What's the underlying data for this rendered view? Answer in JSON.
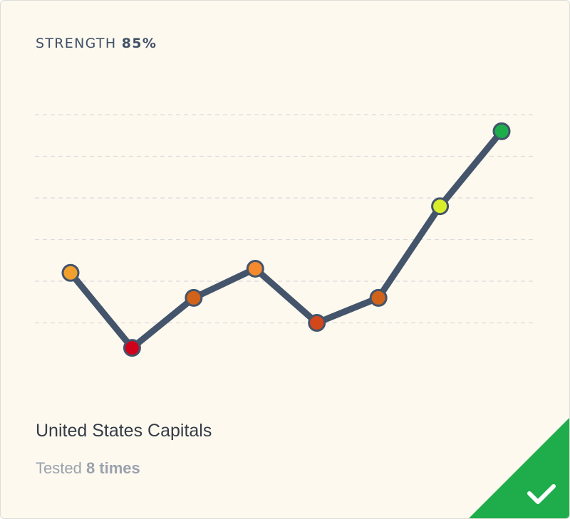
{
  "card": {
    "strength_label": "STRENGTH",
    "strength_value": "85%",
    "title": "United States Capitals",
    "tested_prefix": "Tested",
    "tested_count": "8 times",
    "status_icon": "checkmark-icon",
    "colors": {
      "background": "#fdf9ef",
      "line": "#44546a",
      "gridline": "#dcdcdc",
      "corner_badge": "#1fad4c"
    }
  },
  "chart_data": {
    "type": "line",
    "x": [
      1,
      2,
      3,
      4,
      5,
      6,
      7,
      8
    ],
    "values": [
      4.2,
      2.4,
      3.6,
      4.3,
      3.0,
      3.6,
      5.8,
      7.6
    ],
    "ylim": [
      0,
      10
    ],
    "grid": true,
    "point_colors": [
      "#f2a02d",
      "#d0021b",
      "#d0621a",
      "#f4892e",
      "#d4471a",
      "#d0621a",
      "#d9ee2a",
      "#1fad4c"
    ]
  }
}
